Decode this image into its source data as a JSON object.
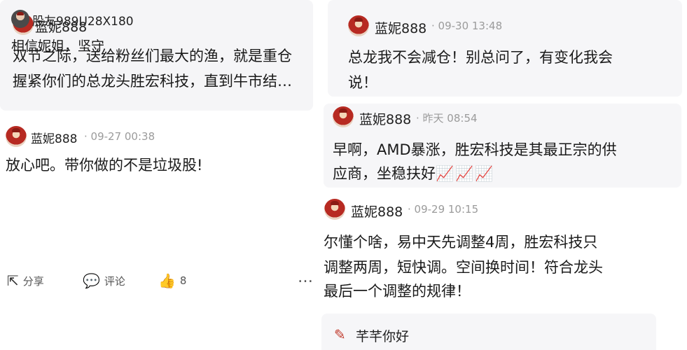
{
  "left": {
    "post": {
      "author": "蓝妮888",
      "line1": "双节之际，送给粉丝们最大的渔，就是重仓",
      "line2": "握紧你们的总龙头胜宏科技，直到牛市结…"
    },
    "comment": {
      "author": "蓝妮888",
      "meta": "· 09-27 00:38",
      "text": "放心吧。带你做的不是垃圾股!"
    },
    "reply": {
      "author": "股友989U28X180",
      "text": "相信妮姐，坚守"
    },
    "actions": {
      "share": "分享",
      "comment": "评论",
      "like_count": "8",
      "more": "…"
    }
  },
  "right": {
    "c1": {
      "author": "蓝妮888",
      "meta": "· 09-30 13:48",
      "line1": "总龙我不会减仓！别总问了，有变化我会",
      "line2": "说！"
    },
    "c2": {
      "author": "蓝妮888",
      "meta": "· 昨天 08:54",
      "line1": "早啊，AMD暴涨，胜宏科技是其最正宗的供",
      "line2": "应商，坐稳扶好",
      "emoji": "📈📈📈"
    },
    "c3": {
      "author": "蓝妮888",
      "meta": "· 09-29 10:15",
      "line1": "尔懂个啥，易中天先调整4周，胜宏科技只",
      "line2": "调整两周，短快调。空间换时间！符合龙头",
      "line3": "最后一个调整的规律！"
    },
    "c4": {
      "author": "芊芊你好"
    }
  }
}
